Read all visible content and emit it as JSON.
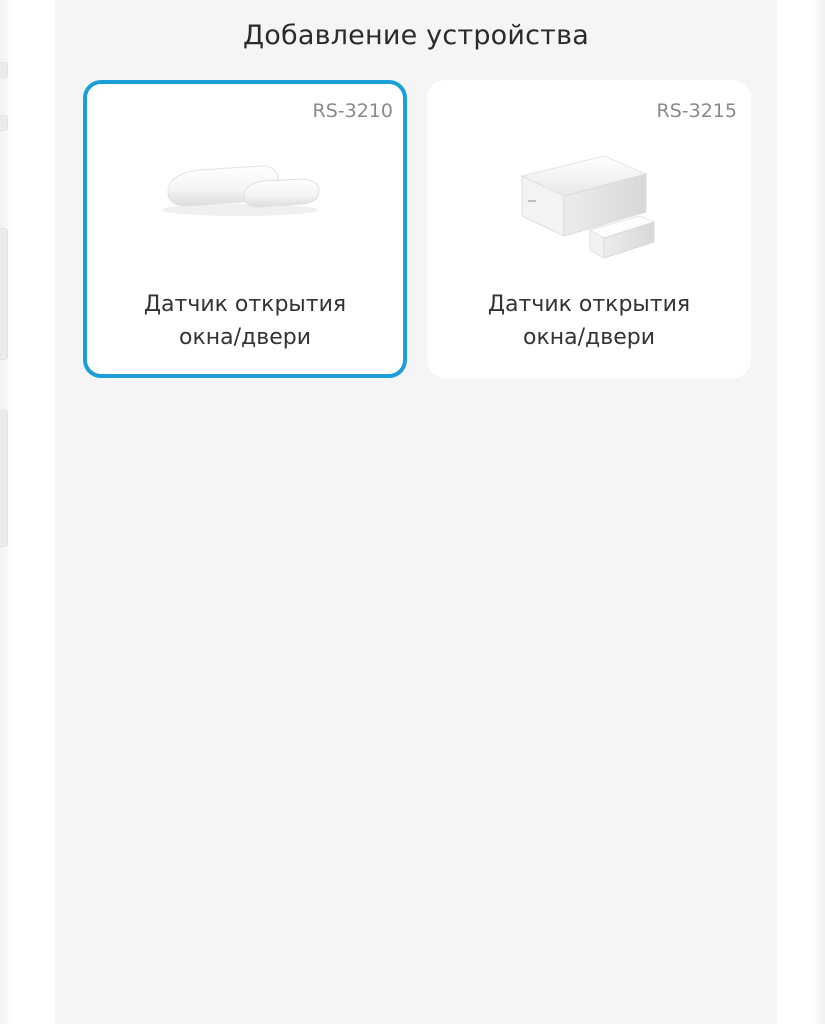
{
  "screen": {
    "title": "Добавление устройства"
  },
  "devices": [
    {
      "model": "RS-3210",
      "name_line1": "Датчик открытия",
      "name_line2": "окна/двери",
      "selected": true,
      "icon": "door-window-sensor-slim-icon"
    },
    {
      "model": "RS-3215",
      "name_line1": "Датчик открытия",
      "name_line2": "окна/двери",
      "selected": false,
      "icon": "door-window-sensor-block-icon"
    }
  ],
  "colors": {
    "screen_background": "#f5f5f5",
    "card_background": "#ffffff",
    "selection_border": "#1a9fd9",
    "model_text": "#8a8a8a",
    "label_text": "#333333"
  }
}
